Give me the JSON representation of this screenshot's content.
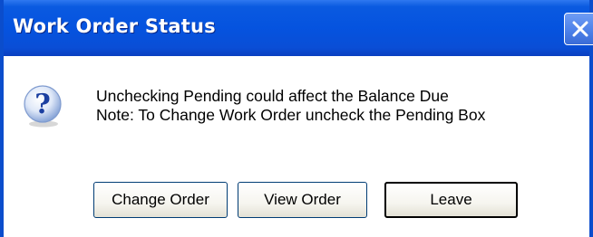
{
  "dialog": {
    "title": "Work Order Status",
    "close_icon": "close-icon",
    "message_icon": "question-icon",
    "message_lines": [
      "Unchecking Pending could affect the Balance Due",
      "Note: To Change Work Order uncheck the Pending Box"
    ],
    "buttons": [
      {
        "label": "Change Order"
      },
      {
        "label": "View Order"
      },
      {
        "label": "Leave",
        "default": true
      }
    ]
  },
  "colors": {
    "titlebar": "#0553df",
    "title_text": "#ffffff",
    "body_bg": "#ffffff",
    "button_border": "#003c74"
  }
}
